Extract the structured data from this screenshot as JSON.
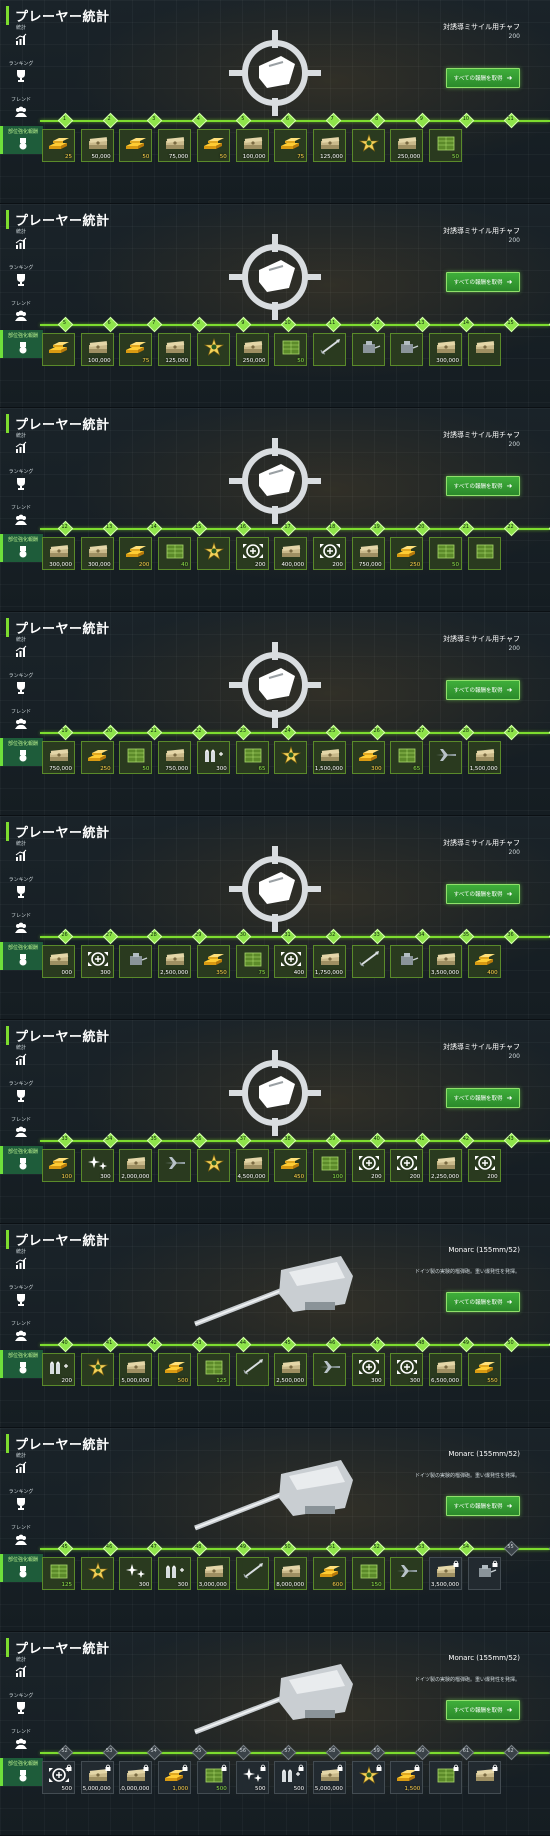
{
  "header": {
    "title": "プレーヤー統計"
  },
  "sidebar": {
    "items": [
      {
        "label": "統計",
        "icon": "chart-icon"
      },
      {
        "label": "ランキング",
        "icon": "trophy-icon"
      },
      {
        "label": "フレンド",
        "icon": "friends-icon"
      },
      {
        "label": "部位強化報酬",
        "icon": "medal-icon",
        "active": true
      }
    ]
  },
  "claim_all_label": "すべての報酬を取得",
  "colors": {
    "accent": "#7ddc2f",
    "button": "#2f9a30",
    "gold": "#ffd24a"
  },
  "screens": [
    {
      "reward": {
        "name": "対誘導ミサイル用チャフ",
        "count": "200",
        "desc": ""
      },
      "hero": "chaff-target-icon",
      "nodes": [
        "1",
        "2",
        "3",
        "4",
        "5",
        "6",
        "7",
        "8",
        "9",
        "10",
        "11"
      ],
      "cells": [
        {
          "type": "gold",
          "amount": "25"
        },
        {
          "type": "cash",
          "amount": "50,000"
        },
        {
          "type": "gold",
          "amount": "50"
        },
        {
          "type": "cash",
          "amount": "75,000"
        },
        {
          "type": "gold",
          "amount": "50"
        },
        {
          "type": "cash",
          "amount": "100,000"
        },
        {
          "type": "gold",
          "amount": "75"
        },
        {
          "type": "cash",
          "amount": "125,000"
        },
        {
          "type": "star",
          "amount": ""
        },
        {
          "type": "cash",
          "amount": "250,000"
        },
        {
          "type": "crate",
          "amount": "50"
        }
      ]
    },
    {
      "reward": {
        "name": "対誘導ミサイル用チャフ",
        "count": "200",
        "desc": ""
      },
      "hero": "chaff-target-icon",
      "nodes": [
        "5",
        "6",
        "7",
        "8",
        "9",
        "10",
        "11",
        "12",
        "13",
        "14",
        "15",
        "16"
      ],
      "cells": [
        {
          "type": "gold",
          "amount": ""
        },
        {
          "type": "cash",
          "amount": "100,000"
        },
        {
          "type": "gold",
          "amount": "75"
        },
        {
          "type": "cash",
          "amount": "125,000"
        },
        {
          "type": "star",
          "amount": ""
        },
        {
          "type": "cash",
          "amount": "250,000"
        },
        {
          "type": "crate",
          "amount": "50"
        },
        {
          "type": "missile",
          "amount": ""
        },
        {
          "type": "module",
          "amount": ""
        },
        {
          "type": "module",
          "amount": ""
        },
        {
          "type": "cash",
          "amount": "300,000"
        },
        {
          "type": "cash",
          "amount": ""
        }
      ]
    },
    {
      "reward": {
        "name": "対誘導ミサイル用チャフ",
        "count": "200",
        "desc": ""
      },
      "hero": "chaff-target-icon",
      "nodes": [
        "12",
        "13",
        "14",
        "15",
        "16",
        "17",
        "18",
        "19",
        "20",
        "21",
        "22",
        "23"
      ],
      "cells": [
        {
          "type": "cash",
          "amount": "300,000"
        },
        {
          "type": "cash",
          "amount": "300,000"
        },
        {
          "type": "gold",
          "amount": "200"
        },
        {
          "type": "crate",
          "amount": "40"
        },
        {
          "type": "star",
          "amount": ""
        },
        {
          "type": "repair",
          "amount": "200"
        },
        {
          "type": "cash",
          "amount": "400,000"
        },
        {
          "type": "repair",
          "amount": "200"
        },
        {
          "type": "cash",
          "amount": "750,000"
        },
        {
          "type": "gold",
          "amount": "250"
        },
        {
          "type": "crate",
          "amount": "50"
        },
        {
          "type": "crate",
          "amount": ""
        }
      ]
    },
    {
      "reward": {
        "name": "対誘導ミサイル用チャフ",
        "count": "200",
        "desc": ""
      },
      "hero": "chaff-target-icon",
      "nodes": [
        "19",
        "20",
        "21",
        "22",
        "23",
        "24",
        "25",
        "26",
        "27",
        "28",
        "29",
        "30"
      ],
      "cells": [
        {
          "type": "cash",
          "amount": "750,000"
        },
        {
          "type": "gold",
          "amount": "250"
        },
        {
          "type": "crate",
          "amount": "50"
        },
        {
          "type": "cash",
          "amount": "750,000"
        },
        {
          "type": "ammo",
          "amount": "300"
        },
        {
          "type": "crate",
          "amount": "65"
        },
        {
          "type": "star",
          "amount": ""
        },
        {
          "type": "cash",
          "amount": "1,500,000"
        },
        {
          "type": "gold",
          "amount": "300"
        },
        {
          "type": "crate",
          "amount": "65"
        },
        {
          "type": "jet",
          "amount": ""
        },
        {
          "type": "cash",
          "amount": "1,500,000"
        }
      ]
    },
    {
      "reward": {
        "name": "対誘導ミサイル用チャフ",
        "count": "200",
        "desc": ""
      },
      "hero": "chaff-target-icon",
      "nodes": [
        "26",
        "27",
        "28",
        "29",
        "30",
        "31",
        "32",
        "33",
        "34",
        "35",
        "36",
        "37"
      ],
      "cells": [
        {
          "type": "cash",
          "amount": "000"
        },
        {
          "type": "repair",
          "amount": "300"
        },
        {
          "type": "module",
          "amount": ""
        },
        {
          "type": "cash",
          "amount": "2,500,000"
        },
        {
          "type": "gold",
          "amount": "350"
        },
        {
          "type": "crate",
          "amount": "75"
        },
        {
          "type": "repair",
          "amount": "400"
        },
        {
          "type": "cash",
          "amount": "1,750,000"
        },
        {
          "type": "missile",
          "amount": ""
        },
        {
          "type": "module",
          "amount": ""
        },
        {
          "type": "cash",
          "amount": "3,500,000"
        },
        {
          "type": "gold",
          "amount": "400"
        }
      ]
    },
    {
      "reward": {
        "name": "対誘導ミサイル用チャフ",
        "count": "200",
        "desc": ""
      },
      "hero": "chaff-target-icon",
      "nodes": [
        "33",
        "34",
        "35",
        "36",
        "37",
        "38",
        "39",
        "40",
        "41",
        "42",
        "43",
        "44"
      ],
      "cells": [
        {
          "type": "gold",
          "amount": "100"
        },
        {
          "type": "sparkle",
          "amount": "300"
        },
        {
          "type": "cash",
          "amount": "2,000,000"
        },
        {
          "type": "jet",
          "amount": ""
        },
        {
          "type": "star",
          "amount": ""
        },
        {
          "type": "cash",
          "amount": "4,500,000"
        },
        {
          "type": "gold",
          "amount": "450"
        },
        {
          "type": "crate",
          "amount": "100"
        },
        {
          "type": "repair",
          "amount": "200"
        },
        {
          "type": "repair",
          "amount": "200"
        },
        {
          "type": "cash",
          "amount": "2,250,000"
        },
        {
          "type": "repair",
          "amount": "200"
        }
      ]
    },
    {
      "reward": {
        "name": "Monarc (155mm/52)",
        "count": "",
        "desc": "ドイツ製の実験的榴弾砲。重い爆発性を発揮。"
      },
      "hero": "turret-icon",
      "nodes": [
        "40",
        "41",
        "42",
        "43",
        "44",
        "45",
        "46",
        "47",
        "48",
        "49",
        "50",
        "51"
      ],
      "cells": [
        {
          "type": "ammo",
          "amount": "200"
        },
        {
          "type": "star",
          "amount": ""
        },
        {
          "type": "cash",
          "amount": "5,000,000"
        },
        {
          "type": "gold",
          "amount": "500"
        },
        {
          "type": "crate",
          "amount": "125"
        },
        {
          "type": "missile",
          "amount": ""
        },
        {
          "type": "cash",
          "amount": "2,500,000"
        },
        {
          "type": "jet",
          "amount": ""
        },
        {
          "type": "repair",
          "amount": "300"
        },
        {
          "type": "repair",
          "amount": "300"
        },
        {
          "type": "cash",
          "amount": "6,500,000"
        },
        {
          "type": "gold",
          "amount": "550"
        }
      ]
    },
    {
      "reward": {
        "name": "Monarc (155mm/52)",
        "count": "",
        "desc": "ドイツ製の実験的榴弾砲。重い爆発性を発揮。"
      },
      "hero": "turret-icon",
      "nodes": [
        "45",
        "46",
        "47",
        "48",
        "49",
        "50",
        "51",
        "52",
        "53",
        "54",
        "55",
        "56"
      ],
      "cells": [
        {
          "type": "crate",
          "amount": "125"
        },
        {
          "type": "star",
          "amount": ""
        },
        {
          "type": "sparkle",
          "amount": "300"
        },
        {
          "type": "ammo",
          "amount": "300"
        },
        {
          "type": "cash",
          "amount": "3,000,000"
        },
        {
          "type": "missile",
          "amount": ""
        },
        {
          "type": "cash",
          "amount": "8,000,000"
        },
        {
          "type": "gold",
          "amount": "600"
        },
        {
          "type": "crate",
          "amount": "150"
        },
        {
          "type": "jet",
          "amount": ""
        },
        {
          "type": "cash",
          "amount": "3,500,000",
          "locked": true
        },
        {
          "type": "module",
          "amount": "",
          "locked": true
        }
      ]
    },
    {
      "reward": {
        "name": "Monarc (155mm/52)",
        "count": "",
        "desc": "ドイツ製の実験的榴弾砲。重い爆発性を発揮。"
      },
      "hero": "turret-icon",
      "nodes": [
        "52",
        "53",
        "54",
        "55",
        "56",
        "57",
        "58",
        "59",
        "60",
        "61",
        "62",
        "63"
      ],
      "cells": [
        {
          "type": "repair",
          "amount": "500",
          "locked": true
        },
        {
          "type": "cash",
          "amount": "5,000,000",
          "locked": true
        },
        {
          "type": "cash",
          "amount": "10,000,000",
          "locked": true
        },
        {
          "type": "gold",
          "amount": "1,000",
          "locked": true
        },
        {
          "type": "crate",
          "amount": "500",
          "locked": true
        },
        {
          "type": "sparkle",
          "amount": "500",
          "locked": true
        },
        {
          "type": "ammo",
          "amount": "500",
          "locked": true
        },
        {
          "type": "cash",
          "amount": "15,000,000",
          "locked": true
        },
        {
          "type": "star",
          "amount": "",
          "locked": true
        },
        {
          "type": "gold",
          "amount": "1,500",
          "locked": true
        },
        {
          "type": "crate",
          "amount": "",
          "locked": true
        },
        {
          "type": "cash",
          "amount": "",
          "locked": true
        }
      ],
      "locked_from": 0
    }
  ]
}
